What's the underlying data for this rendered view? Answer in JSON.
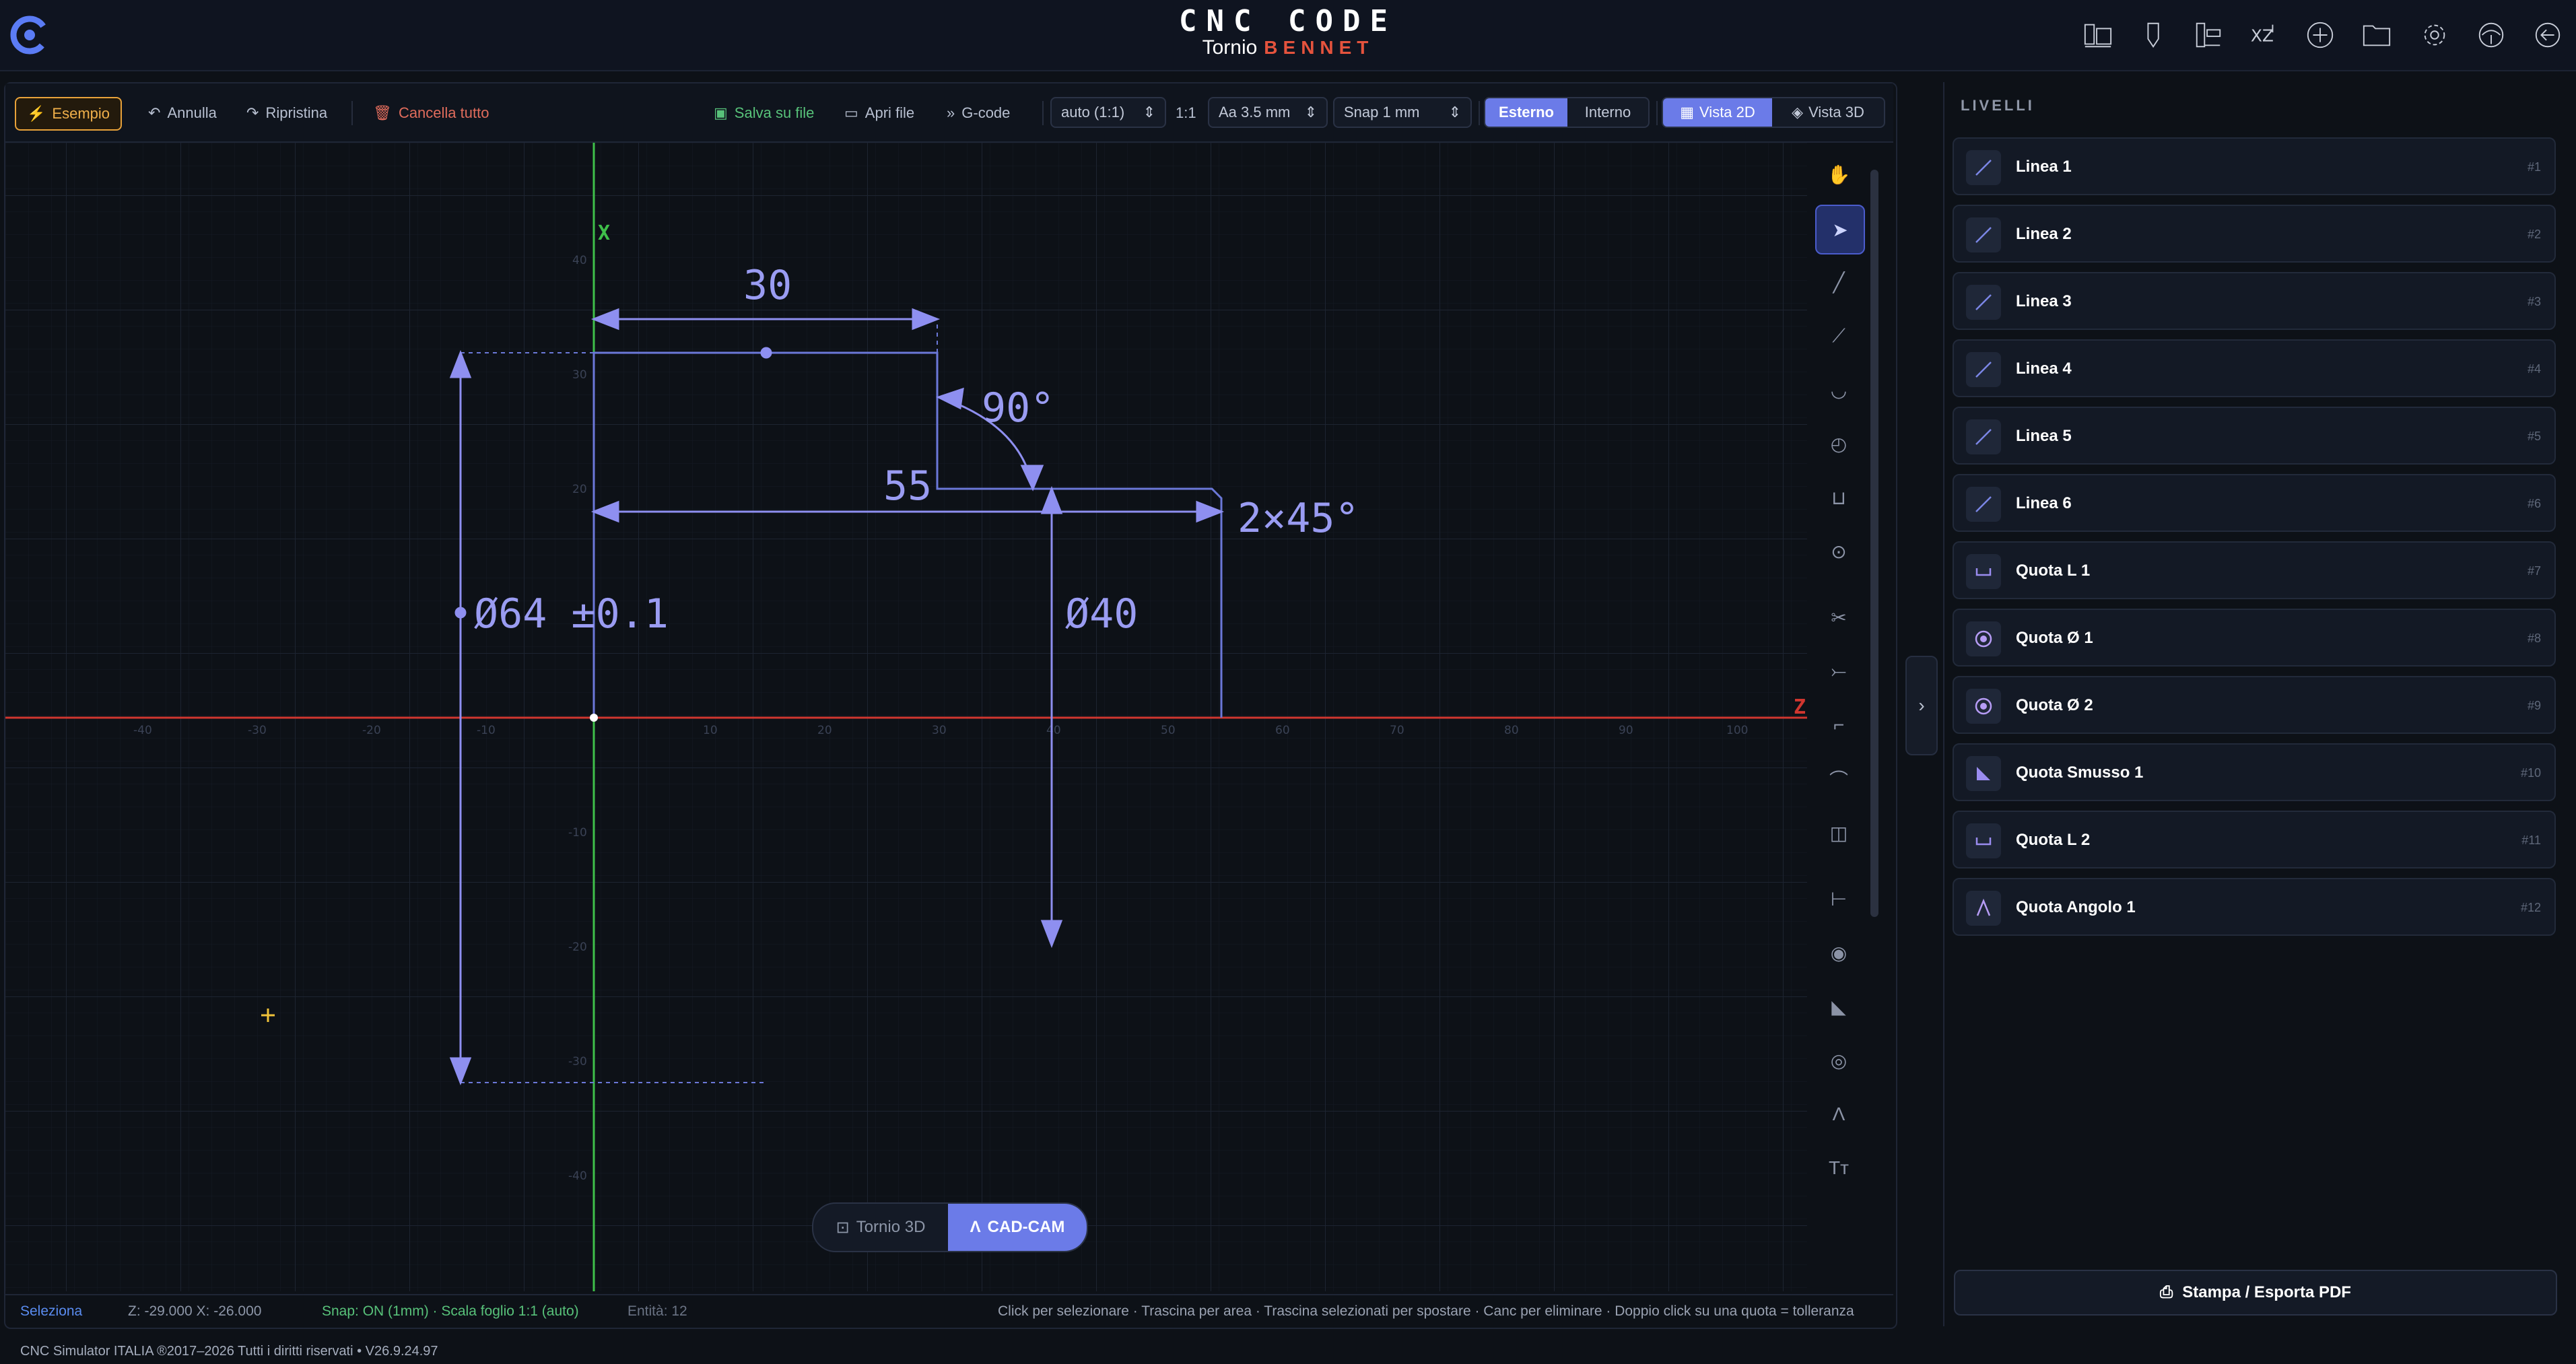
{
  "header": {
    "brand": "CNC CODE",
    "subtitle_prefix": "Tornio",
    "subtitle_brand": "BENNET",
    "icons": [
      "machines-icon",
      "tools-icon",
      "fixture-icon",
      "xz-coordinates-icon",
      "add-icon",
      "folder-icon",
      "settings-icon",
      "language-icon",
      "logout-icon"
    ],
    "icon_xz_label": "XZ"
  },
  "toolbar": {
    "example": "Esempio",
    "undo": "Annulla",
    "redo": "Ripristina",
    "clear_all": "Cancella tutto",
    "save_file": "Salva su file",
    "open_file": "Apri file",
    "gcode": "G-code",
    "scale_select": "auto (1:1)",
    "scale_ratio": "1:1",
    "text_size_select": "Aa 3.5 mm",
    "snap_select": "Snap 1 mm",
    "outer": "Esterno",
    "inner": "Interno",
    "view2d": "Vista 2D",
    "view3d": "Vista 3D"
  },
  "canvas": {
    "axis_x_label": "X",
    "axis_z_label": "Z",
    "x_ticks": [
      "-40",
      "-30",
      "-20",
      "-10",
      "10",
      "20",
      "30",
      "40",
      "50",
      "60",
      "70",
      "80",
      "90",
      "100"
    ],
    "y_ticks": [
      "40",
      "30",
      "20",
      "-10",
      "-20",
      "-30",
      "-40"
    ],
    "dimensions": {
      "len_30": "30",
      "angle_90": "90°",
      "len_55": "55",
      "chamfer": "2×45°",
      "dia_64": "Ø64 ±0.1",
      "dia_40": "Ø40"
    }
  },
  "mode_switch": {
    "lathe3d": "Tornio 3D",
    "cadcam": "CAD-CAM"
  },
  "status": {
    "tool": "Seleziona",
    "coords": "Z: -29.000 X: -26.000",
    "snap": "Snap: ON (1mm) · Scala foglio 1:1 (auto)",
    "entities": "Entità: 12",
    "hint": "Click per selezionare · Trascina per area · Trascina selezionati per spostare · Canc per eliminare · Doppio click su una quota = tolleranza"
  },
  "panel": {
    "title": "LIVELLI",
    "layers": [
      {
        "name": "Linea 1",
        "num": "#1",
        "icon": "line-icon"
      },
      {
        "name": "Linea 2",
        "num": "#2",
        "icon": "line-icon"
      },
      {
        "name": "Linea 3",
        "num": "#3",
        "icon": "line-icon"
      },
      {
        "name": "Linea 4",
        "num": "#4",
        "icon": "line-icon"
      },
      {
        "name": "Linea 5",
        "num": "#5",
        "icon": "line-icon"
      },
      {
        "name": "Linea 6",
        "num": "#6",
        "icon": "line-icon"
      },
      {
        "name": "Quota L 1",
        "num": "#7",
        "icon": "linear-dimension-icon"
      },
      {
        "name": "Quota Ø 1",
        "num": "#8",
        "icon": "diameter-dimension-icon"
      },
      {
        "name": "Quota Ø 2",
        "num": "#9",
        "icon": "diameter-dimension-icon"
      },
      {
        "name": "Quota Smusso 1",
        "num": "#10",
        "icon": "chamfer-dimension-icon"
      },
      {
        "name": "Quota L 2",
        "num": "#11",
        "icon": "linear-dimension-icon"
      },
      {
        "name": "Quota Angolo 1",
        "num": "#12",
        "icon": "angle-dimension-icon"
      }
    ],
    "print": "Stampa / Esporta PDF"
  },
  "footer": "CNC Simulator ITALIA  ®2017–2026  Tutti i diritti riservati  •  V26.9.24.97",
  "colors": {
    "accent": "#6b7be8",
    "dimension": "#8e8ff0",
    "axis_x": "#3fbf4a",
    "axis_z": "#d0362f",
    "brand_red": "#e5533d",
    "example_button": "#e8a23a",
    "clear_button": "#e06c5c",
    "save_green": "#58c27a"
  }
}
